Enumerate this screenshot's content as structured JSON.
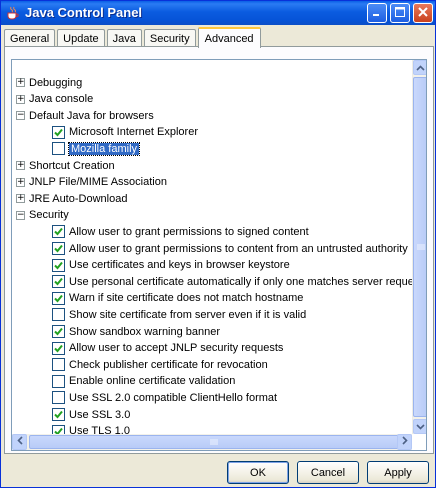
{
  "window": {
    "title": "Java Control Panel"
  },
  "tabs": [
    {
      "label": "General"
    },
    {
      "label": "Update"
    },
    {
      "label": "Java"
    },
    {
      "label": "Security"
    },
    {
      "label": "Advanced",
      "active": true
    }
  ],
  "tree": {
    "items": [
      {
        "type": "group",
        "label": "Debugging",
        "expanded": false
      },
      {
        "type": "group",
        "label": "Java console",
        "expanded": false
      },
      {
        "type": "group",
        "label": "Default Java for browsers",
        "expanded": true
      },
      {
        "type": "check",
        "label": "Microsoft Internet Explorer",
        "checked": true
      },
      {
        "type": "check",
        "label": "Mozilla family",
        "checked": false,
        "selected": true
      },
      {
        "type": "group",
        "label": "Shortcut Creation",
        "expanded": false
      },
      {
        "type": "group",
        "label": "JNLP File/MIME Association",
        "expanded": false
      },
      {
        "type": "group",
        "label": "JRE Auto-Download",
        "expanded": false
      },
      {
        "type": "group",
        "label": "Security",
        "expanded": true
      },
      {
        "type": "check",
        "label": "Allow user to grant permissions to signed content",
        "checked": true
      },
      {
        "type": "check",
        "label": "Allow user to grant permissions to content from an untrusted authority",
        "checked": true
      },
      {
        "type": "check",
        "label": "Use certificates and keys in browser keystore",
        "checked": true
      },
      {
        "type": "check",
        "label": "Use personal certificate automatically if only one matches server reques",
        "checked": true
      },
      {
        "type": "check",
        "label": "Warn if site certificate does not match hostname",
        "checked": true
      },
      {
        "type": "check",
        "label": "Show site certificate from server even if it is valid",
        "checked": false
      },
      {
        "type": "check",
        "label": "Show sandbox warning banner",
        "checked": true
      },
      {
        "type": "check",
        "label": "Allow user to accept JNLP security requests",
        "checked": true
      },
      {
        "type": "check",
        "label": "Check publisher certificate for revocation",
        "checked": false
      },
      {
        "type": "check",
        "label": "Enable online certificate validation",
        "checked": false
      },
      {
        "type": "check",
        "label": "Use SSL 2.0 compatible ClientHello format",
        "checked": false
      },
      {
        "type": "check",
        "label": "Use SSL 3.0",
        "checked": true
      },
      {
        "type": "check",
        "label": "Use TLS 1.0",
        "checked": true
      }
    ]
  },
  "buttons": {
    "ok": "OK",
    "cancel": "Cancel",
    "apply": "Apply"
  },
  "colors": {
    "titlebar": "#0653d7",
    "selection": "#316ac5",
    "check": "#21a121",
    "tab_highlight": "#ffc83c"
  },
  "icons": {
    "app": "java-cup-icon",
    "minimize": "minimize-icon",
    "maximize": "maximize-icon",
    "close": "close-icon"
  }
}
